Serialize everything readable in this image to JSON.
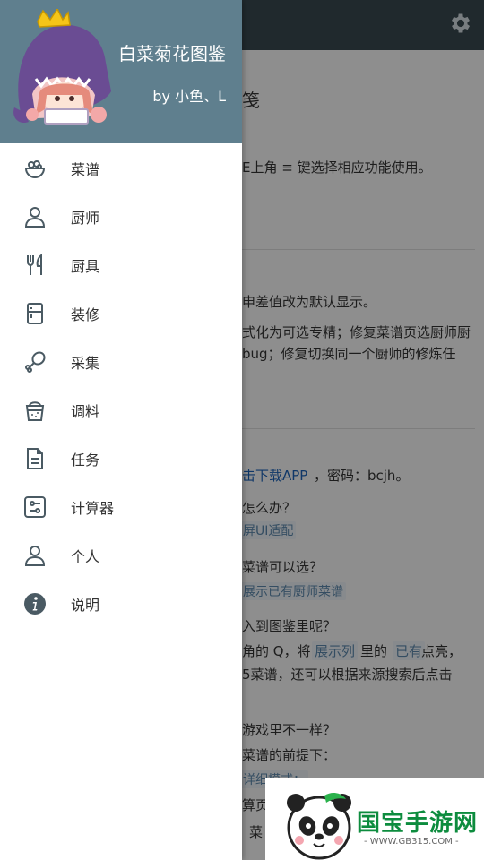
{
  "drawer": {
    "title": "白菜菊花图鉴",
    "author": "by 小鱼、L",
    "items": [
      {
        "label": "菜谱",
        "icon": "bowl-icon"
      },
      {
        "label": "厨师",
        "icon": "person-icon"
      },
      {
        "label": "厨具",
        "icon": "fork-knife-icon"
      },
      {
        "label": "装修",
        "icon": "fridge-icon"
      },
      {
        "label": "采集",
        "icon": "drumstick-icon"
      },
      {
        "label": "调料",
        "icon": "seasoning-jar-icon"
      },
      {
        "label": "任务",
        "icon": "document-icon"
      },
      {
        "label": "计算器",
        "icon": "calculator-icon"
      },
      {
        "label": "个人",
        "icon": "user-icon"
      },
      {
        "label": "说明",
        "icon": "info-icon"
      }
    ]
  },
  "background": {
    "lines": [
      {
        "text": "笺",
        "kind": "text"
      },
      {
        "text": "E上角 ≡ 键选择相应功能使用。",
        "kind": "text"
      },
      {
        "text": "申差值改为默认显示。",
        "kind": "text"
      },
      {
        "text": "式化为可选专精；修复菜谱页选厨师厨",
        "kind": "text"
      },
      {
        "text": "bug；修复切换同一个厨师的修炼任",
        "kind": "text"
      },
      {
        "text": "击下载APP",
        "kind": "link"
      },
      {
        "text": "，密码：bcjh。",
        "kind": "text"
      },
      {
        "text": "怎么办？",
        "kind": "text"
      },
      {
        "text": "屏UI适配",
        "kind": "tag"
      },
      {
        "text": "菜谱可以选？",
        "kind": "text"
      },
      {
        "text": "展示已有厨师菜谱",
        "kind": "tag"
      },
      {
        "text": "入到图鉴里呢？",
        "kind": "text"
      },
      {
        "text": "角的 Q，将 ",
        "kind": "text"
      },
      {
        "text": "展示列",
        "kind": "tag"
      },
      {
        "text": " 里的 ",
        "kind": "text"
      },
      {
        "text": "已有",
        "kind": "tag"
      },
      {
        "text": " 点亮，",
        "kind": "text"
      },
      {
        "text": "5菜谱，还可以根据来源搜索后点击",
        "kind": "text"
      },
      {
        "text": "游戏里不一样？",
        "kind": "text"
      },
      {
        "text": "菜谱的前提下：",
        "kind": "text"
      },
      {
        "text": "详细模式：",
        "kind": "tag"
      },
      {
        "text": "算页",
        "kind": "text"
      },
      {
        "text": "菜",
        "kind": "text"
      }
    ]
  },
  "watermark": {
    "brand": "国宝手游网",
    "url": "- WWW.GB315.COM -"
  },
  "colors": {
    "header": "#5f7f8e",
    "topbar": "#37474f",
    "icon": "#4a5a63",
    "brand_green": "#0d8c3e"
  }
}
